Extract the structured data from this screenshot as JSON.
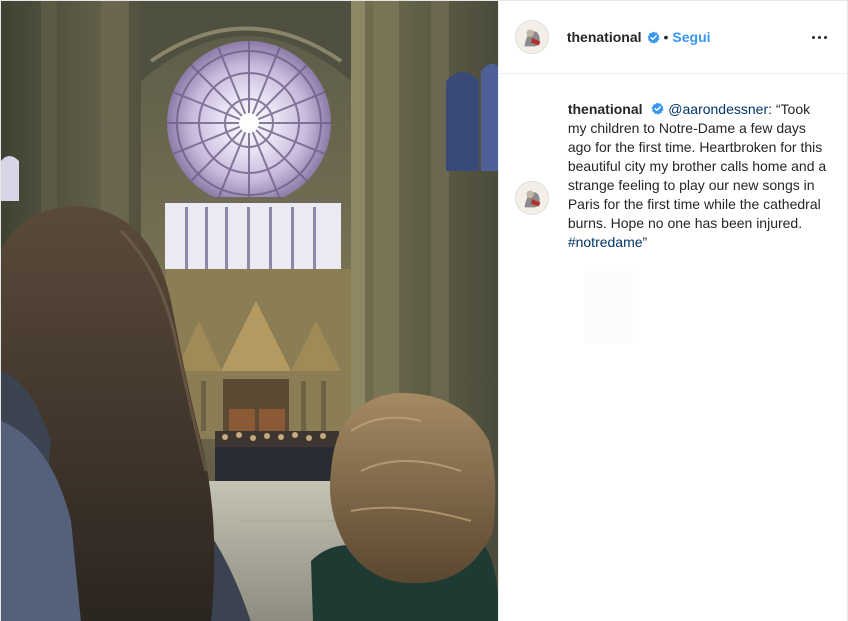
{
  "post": {
    "username": "thenational",
    "separator": "•",
    "follow_label": "Segui",
    "more_icon": "more-horizontal-icon",
    "verified_icon": "verified-badge-icon",
    "colors": {
      "link": "#3897f0",
      "mention": "#003569",
      "text": "#262626"
    }
  },
  "caption": {
    "author": "thenational",
    "mention": "@aarondessner",
    "text_before": ": “Took my children to Notre-Dame a few days ago for the first time. Heartbroken for this beautiful city my brother calls home and a strange feeling to play our new songs in Paris for the first time while the cathedral burns. Hope no one has been injured. ",
    "hashtag": "#notredame",
    "text_after": "”"
  }
}
